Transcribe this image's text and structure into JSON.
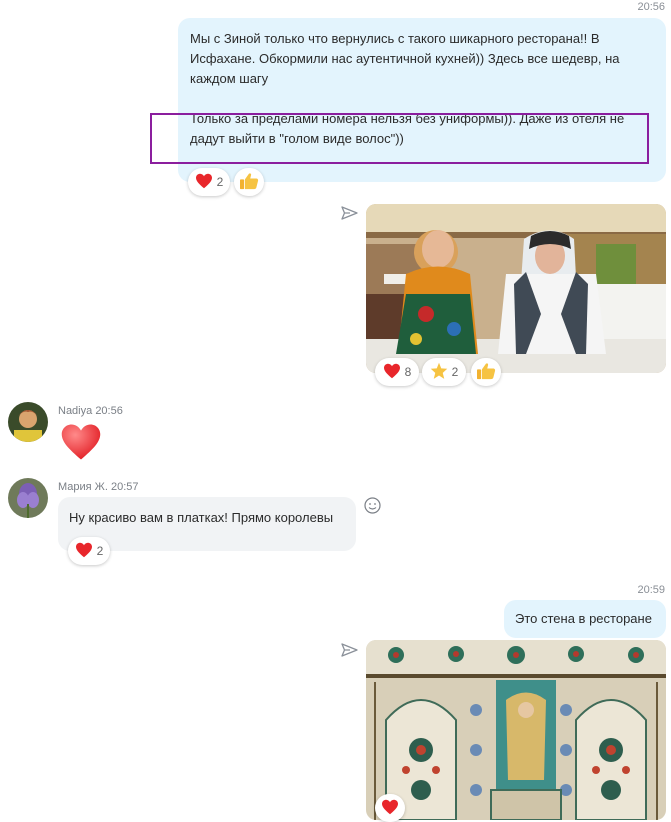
{
  "colors": {
    "outgoing_bubble": "#e3f4fd",
    "incoming_bubble": "#f1f3f5",
    "highlight_border": "#8b1e9e"
  },
  "messages": {
    "m1": {
      "time": "20:56",
      "line1": "Мы с Зиной только что вернулись с такого шикарного ресторана!! В",
      "line2": "Исфахане. Обкормили нас аутентичной кухней))  Здесь все шедевр, на",
      "line3": "каждом шагу",
      "line4": "Только за пределами номера нельзя без униформы)). Даже из отеля не",
      "line5": "дадут выйти в \"голом виде волос\"))",
      "reactions": {
        "heart_count": "2"
      }
    },
    "photo1": {
      "reactions": {
        "heart_count": "8",
        "star_count": "2"
      }
    },
    "m2": {
      "sender": "Nadiya",
      "time": "20:56"
    },
    "m3": {
      "sender": "Мария Ж.",
      "time": "20:57",
      "text": "Ну красиво вам в платках! Прямо королевы",
      "reactions": {
        "heart_count": "2"
      }
    },
    "m4": {
      "time": "20:59",
      "text": "Это стена в ресторане"
    }
  },
  "icons": [
    "send-icon",
    "heart-icon",
    "thumbs-up-icon",
    "star-icon",
    "emoji-icon",
    "avatar"
  ]
}
